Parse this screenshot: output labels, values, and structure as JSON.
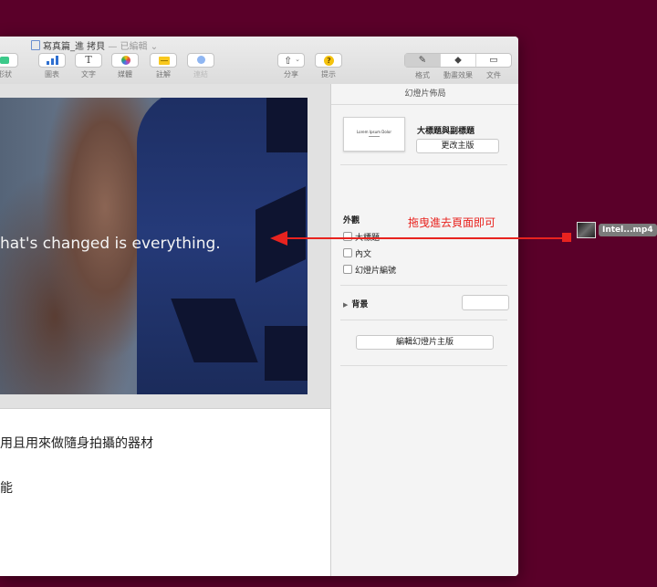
{
  "window": {
    "title": "寫真篇_進 拷貝",
    "status": "— 已編輯",
    "title_chevron": "⌄"
  },
  "toolbar": {
    "items": [
      {
        "label": "形狀",
        "icon": "shape-icon"
      },
      {
        "label": "圖表",
        "icon": "chart-icon"
      },
      {
        "label": "文字",
        "icon": "text-icon",
        "glyph": "T"
      },
      {
        "label": "媒體",
        "icon": "media-icon"
      },
      {
        "label": "註解",
        "icon": "comment-icon"
      },
      {
        "label": "連結",
        "icon": "link-icon"
      },
      {
        "label": "分享",
        "icon": "share-icon",
        "glyph": "⇧",
        "chevron": "⌄"
      },
      {
        "label": "提示",
        "icon": "tips-icon",
        "glyph": "?"
      }
    ],
    "inspector_tabs": [
      {
        "label": "格式",
        "icon": "format-brush-icon",
        "glyph": "✎",
        "selected": true
      },
      {
        "label": "動畫效果",
        "icon": "animate-diamond-icon",
        "glyph": "◆"
      },
      {
        "label": "文件",
        "icon": "document-icon",
        "glyph": "▭"
      }
    ],
    "colors": {
      "shape": "#3cc98a",
      "chart": "#2e6fd0"
    }
  },
  "slide": {
    "text": "hat's changed is everything."
  },
  "notes": {
    "line1": "用且用來做隨身拍攝的器材",
    "line2": "能"
  },
  "sidebar": {
    "header": "幻燈片佈局",
    "thumbnail_text": "Lorem Ipsum Dolor",
    "layout_name": "大標題與副標題",
    "change_master_button": "更改主版",
    "appearance_title": "外觀",
    "checkboxes": [
      {
        "label": "大標題",
        "checked": false
      },
      {
        "label": "內文",
        "checked": false
      },
      {
        "label": "幻燈片編號",
        "checked": false
      }
    ],
    "background_label": "背景",
    "background_toggle": "▶",
    "edit_master_button": "編輯幻燈片主版"
  },
  "annotation": {
    "text": "拖曳進去頁面即可",
    "color": "#e8231f"
  },
  "dragged_file": {
    "name": "Intel...mp4"
  }
}
